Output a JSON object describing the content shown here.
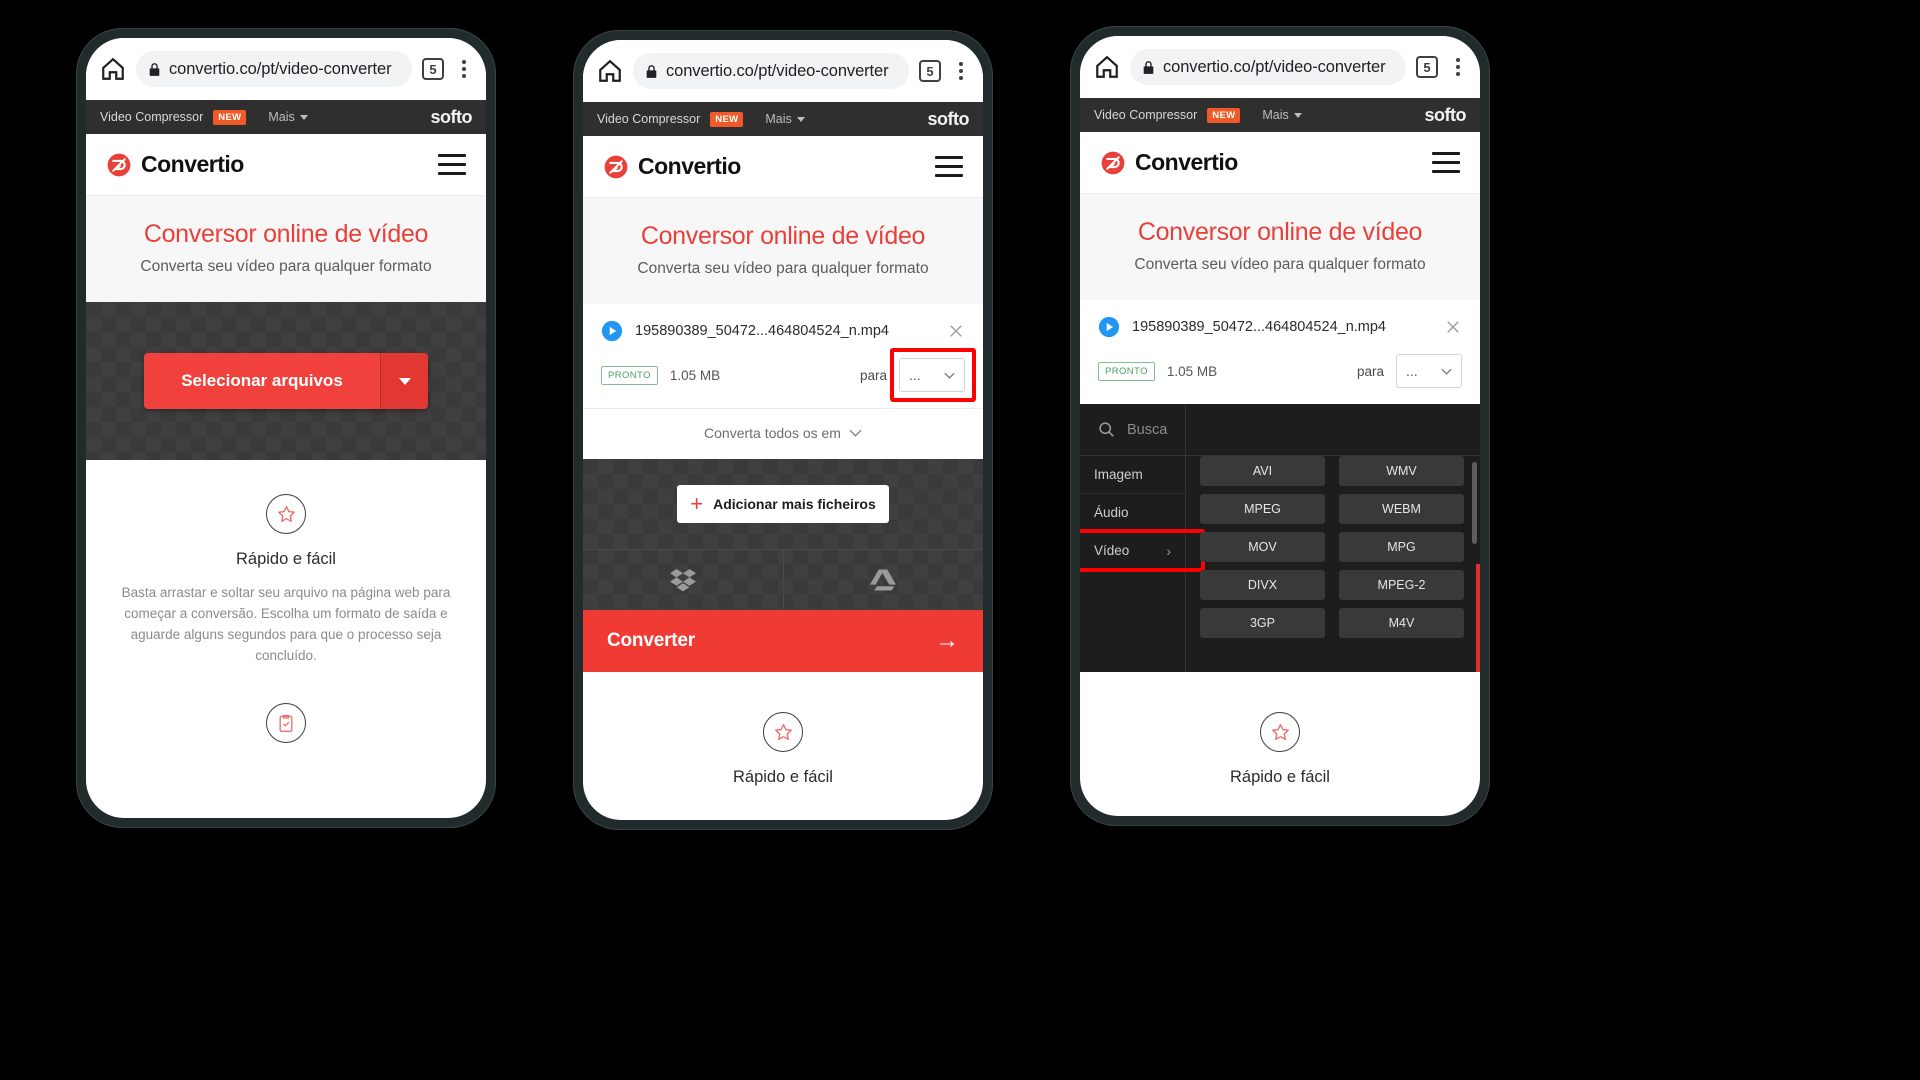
{
  "browser": {
    "url": "convertio.co/pt/video-converter",
    "tab_count": "5",
    "home_icon": "home-icon",
    "lock_icon": "lock-icon",
    "menu_icon": "kebab-menu-icon"
  },
  "softo_bar": {
    "link_label": "Video Compressor",
    "badge": "NEW",
    "more_label": "Mais",
    "logo": "softo"
  },
  "site_header": {
    "brand": "Convertio",
    "menu_icon": "hamburger-icon"
  },
  "hero": {
    "title": "Conversor online de vídeo",
    "subtitle": "Converta seu vídeo para qualquer formato"
  },
  "dropzone": {
    "select_label": "Selecionar arquivos",
    "dropdown_icon": "caret-down-icon"
  },
  "features": [
    {
      "icon": "star-icon",
      "title": "Rápido e fácil",
      "body": "Basta arrastar e soltar seu arquivo na página web para começar a conversão. Escolha um formato de saída e aguarde alguns segundos para que o processo seja concluído."
    },
    {
      "icon": "clipboard-check-icon",
      "title": "Rápido e fácil"
    }
  ],
  "file": {
    "name": "195890389_50472...464804524_n.mp4",
    "status": "PRONTO",
    "size": "1.05 MB",
    "para_label": "para",
    "format_value": "...",
    "play_icon": "play-icon",
    "close_icon": "close-icon",
    "chevron_icon": "chevron-down-icon"
  },
  "convert_all": {
    "label": "Converta todos os em",
    "chevron_icon": "chevron-down-icon"
  },
  "actions": {
    "add_more": "Adicionar mais ficheiros",
    "plus_icon": "plus-icon",
    "dropbox_icon": "dropbox-icon",
    "gdrive_icon": "google-drive-icon",
    "convert_label": "Converter",
    "arrow_icon": "arrow-right-icon"
  },
  "picker": {
    "search_placeholder": "Busca",
    "search_icon": "search-icon",
    "categories": [
      {
        "label": "Imagem",
        "selected": false
      },
      {
        "label": "Áudio",
        "selected": false
      },
      {
        "label": "Vídeo",
        "selected": true
      }
    ],
    "category_chevron": "chevron-right-icon",
    "formats": [
      "AVI",
      "WMV",
      "MPEG",
      "WEBM",
      "MOV",
      "MPG",
      "DIVX",
      "MPEG-2",
      "3GP",
      "M4V"
    ]
  },
  "colors": {
    "accent_red": "#e8413a",
    "convert_bar": "#ef3b33",
    "badge_orange": "#f05a28",
    "highlight": "#ff0000",
    "status_green": "#4e9e62",
    "dark_panel": "#1d1d1d"
  }
}
